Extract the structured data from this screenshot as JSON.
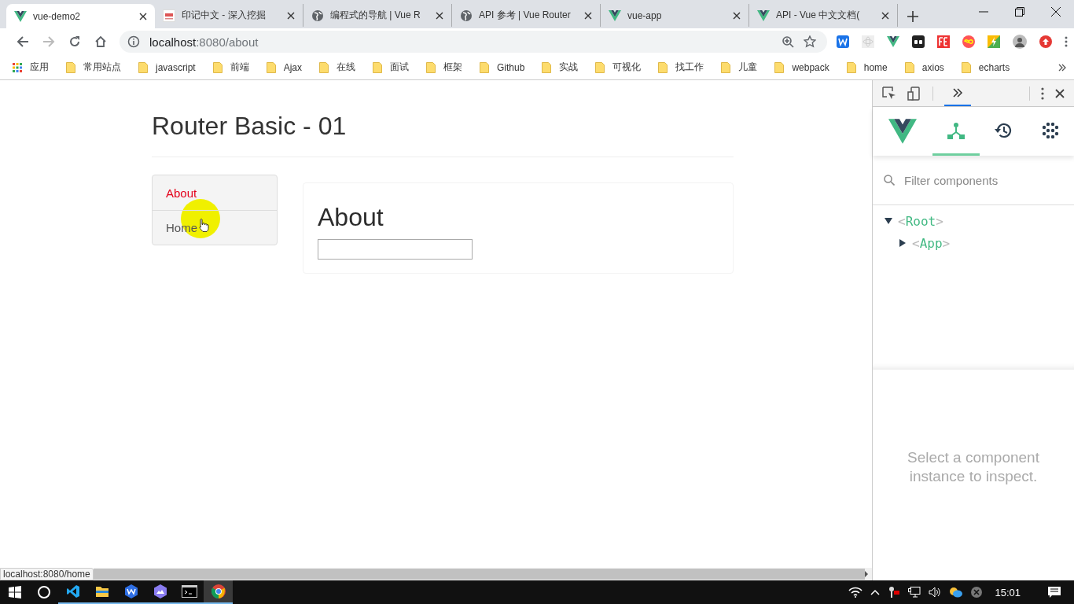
{
  "browser": {
    "tabs": [
      {
        "title": "vue-demo2",
        "kind": "vue",
        "selected": true
      },
      {
        "title": "印记中文 - 深入挖掘",
        "kind": "yinji",
        "selected": false
      },
      {
        "title": "编程式的导航 | Vue R",
        "kind": "globe",
        "selected": false
      },
      {
        "title": "API 参考 | Vue Router",
        "kind": "globe",
        "selected": false
      },
      {
        "title": "vue-app",
        "kind": "vue",
        "selected": false
      },
      {
        "title": "API - Vue 中文文档(",
        "kind": "vue",
        "selected": false
      }
    ],
    "address": {
      "host": "localhost",
      "path": ":8080/about"
    },
    "bookmarks": [
      {
        "label": "应用",
        "kind": "apps"
      },
      {
        "label": "常用站点",
        "kind": "folder"
      },
      {
        "label": "javascript",
        "kind": "folder"
      },
      {
        "label": "前端",
        "kind": "folder"
      },
      {
        "label": "Ajax",
        "kind": "folder"
      },
      {
        "label": "在线",
        "kind": "folder"
      },
      {
        "label": "面试",
        "kind": "folder"
      },
      {
        "label": "框架",
        "kind": "folder"
      },
      {
        "label": "Github",
        "kind": "folder"
      },
      {
        "label": "实战",
        "kind": "folder"
      },
      {
        "label": "可视化",
        "kind": "folder"
      },
      {
        "label": "找工作",
        "kind": "folder"
      },
      {
        "label": "儿童",
        "kind": "folder"
      },
      {
        "label": "webpack",
        "kind": "folder"
      },
      {
        "label": "home",
        "kind": "folder"
      },
      {
        "label": "axios",
        "kind": "folder"
      },
      {
        "label": "echarts",
        "kind": "folder"
      }
    ],
    "status_url": "localhost:8080/home"
  },
  "page": {
    "title": "Router Basic - 01",
    "nav": [
      {
        "label": "About",
        "selected": true
      },
      {
        "label": "Home",
        "selected": false
      }
    ],
    "view": {
      "heading": "About"
    }
  },
  "devtools": {
    "vue_tabs": [
      {
        "kind": "components",
        "selected": true
      },
      {
        "kind": "history",
        "selected": false
      },
      {
        "kind": "vuex",
        "selected": false
      }
    ],
    "filter": {
      "placeholder": "Filter components"
    },
    "tree": [
      {
        "open": "<",
        "name": "Root",
        "close": ">",
        "expanded": true,
        "children": [
          {
            "open": "<",
            "name": "App",
            "close": ">",
            "expanded": false
          }
        ]
      }
    ],
    "hint": "Select a component instance to inspect."
  },
  "taskbar": {
    "apps": [
      {
        "kind": "vscode",
        "active": false
      },
      {
        "kind": "explorer",
        "active": false
      },
      {
        "kind": "wps",
        "active": false
      },
      {
        "kind": "hex",
        "active": false
      },
      {
        "kind": "cmd",
        "active": false
      },
      {
        "kind": "chrome",
        "active": true
      }
    ],
    "clock": "15:01"
  }
}
